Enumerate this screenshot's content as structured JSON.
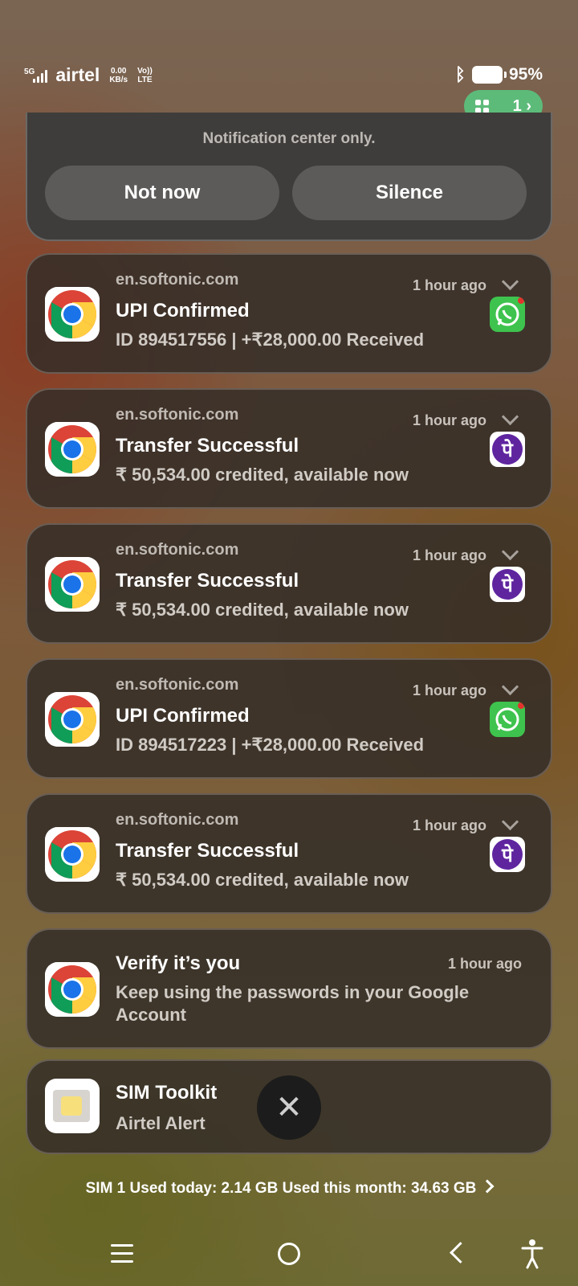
{
  "status_bar": {
    "network_type": "5G",
    "carrier": "airtel",
    "speed_value": "0.00",
    "speed_unit": "KB/s",
    "volte_top": "Vo))",
    "volte_bottom": "LTE",
    "battery_percent": "95%",
    "notification_pill_count": "1"
  },
  "top_card": {
    "hint": "Notification center only.",
    "not_now_label": "Not now",
    "silence_label": "Silence"
  },
  "notifications": [
    {
      "source": "en.softonic.com",
      "title": "UPI Confirmed",
      "body": "ID 894517556 | +₹28,000.00 Received",
      "time": "1 hour ago",
      "app_icon": "whatsapp-icon"
    },
    {
      "source": "en.softonic.com",
      "title": "Transfer Successful",
      "body": "₹ 50,534.00 credited, available now",
      "time": "1 hour ago",
      "app_icon": "phonepe-icon",
      "app_glyph": "पे"
    },
    {
      "source": "en.softonic.com",
      "title": "Transfer Successful",
      "body": "₹ 50,534.00 credited, available now",
      "time": "1 hour ago",
      "app_icon": "phonepe-icon",
      "app_glyph": "पे"
    },
    {
      "source": "en.softonic.com",
      "title": "UPI Confirmed",
      "body": "ID 894517223 | +₹28,000.00 Received",
      "time": "1 hour ago",
      "app_icon": "whatsapp-icon"
    },
    {
      "source": "en.softonic.com",
      "title": "Transfer Successful",
      "body": "₹ 50,534.00 credited, available now",
      "time": "1 hour ago",
      "app_icon": "phonepe-icon",
      "app_glyph": "पे"
    },
    {
      "title": "Verify it’s you",
      "body_line1": "Keep using the passwords in your Google",
      "body_line2": "Account",
      "time": "1 hour ago"
    },
    {
      "title": "SIM Toolkit",
      "body": "Airtel Alert"
    }
  ],
  "data_usage": "SIM 1 Used today: 2.14 GB  Used this month: 34.63 GB",
  "colors": {
    "pill_green": "#5dbb7a",
    "phonepe_purple": "#5f259f",
    "whatsapp_green": "#3ec34e",
    "card_bg": "#342d28"
  }
}
